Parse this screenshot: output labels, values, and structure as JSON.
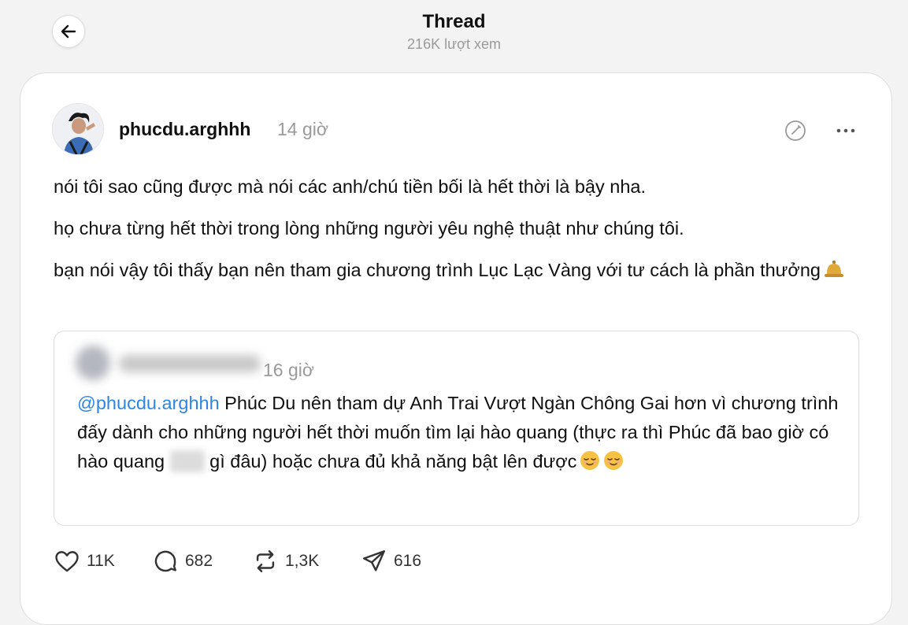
{
  "header": {
    "title": "Thread",
    "views": "216K lượt xem"
  },
  "post": {
    "username": "phucdu.arghhh",
    "time": "14 giờ",
    "paragraphs": [
      "nói tôi sao cũng được mà nói các anh/chú tiền bối là hết thời là bậy nha.",
      "họ chưa từng hết thời trong lòng những người yêu nghệ thuật như chúng tôi.",
      "bạn nói vậy tôi thấy bạn nên tham gia chương trình Lục Lạc Vàng với tư cách là phần thưởng"
    ],
    "trailing_emoji": "bell-emoji"
  },
  "quote": {
    "time": "16 giờ",
    "mention": "@phucdu.arghhh",
    "text_part1": " Phúc Du nên tham dự Anh Trai Vượt Ngàn Chông Gai hơn vì chương trình đấy dành cho những người hết thời muốn tìm lại hào quang (thực ra thì Phúc đã bao giờ có hào quang ",
    "text_part2": " gì đâu) hoặc chưa đủ khả năng bật lên được",
    "trailing_emoji": "relieved-face-emoji"
  },
  "actions": {
    "likes": "11K",
    "comments": "682",
    "reposts": "1,3K",
    "shares": "616"
  },
  "icons": [
    "arrow-left-icon",
    "edit-icon",
    "more-icon",
    "heart-icon",
    "comment-icon",
    "repost-icon",
    "send-icon"
  ],
  "colors": {
    "background": "#f3f3f3",
    "card": "#ffffff",
    "text": "#101010",
    "muted": "#9a9a9a",
    "link": "#2d86e6"
  }
}
